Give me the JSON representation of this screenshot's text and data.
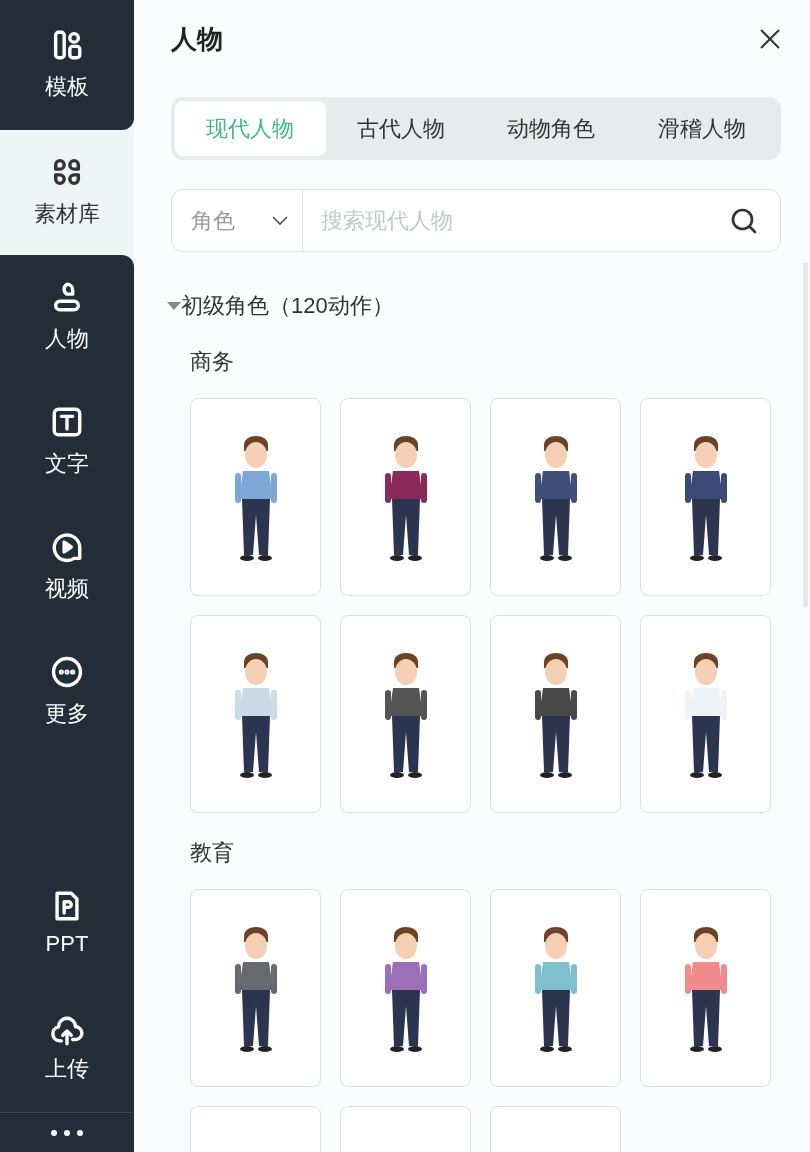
{
  "sidebar": {
    "items": [
      {
        "label": "模板",
        "kind": "template",
        "selected": false
      },
      {
        "label": "素材库",
        "kind": "library",
        "selected": true
      },
      {
        "label": "人物",
        "kind": "person",
        "selected": false
      },
      {
        "label": "文字",
        "kind": "text",
        "selected": false
      },
      {
        "label": "视频",
        "kind": "video",
        "selected": false
      },
      {
        "label": "更多",
        "kind": "more",
        "selected": false
      }
    ],
    "bottom_items": [
      {
        "label": "PPT",
        "kind": "ppt"
      },
      {
        "label": "上传",
        "kind": "upload"
      }
    ]
  },
  "panel": {
    "title": "人物",
    "tabs": [
      {
        "label": "现代人物",
        "selected": true
      },
      {
        "label": "古代人物",
        "selected": false
      },
      {
        "label": "动物角色",
        "selected": false
      },
      {
        "label": "滑稽人物",
        "selected": false
      }
    ],
    "search": {
      "filter": "角色",
      "placeholder": "搜索现代人物"
    },
    "section": {
      "title": "初级角色（120动作）",
      "expanded": true,
      "groups": [
        {
          "title": "商务",
          "cards": [
            {
              "color": "#7fa7d6"
            },
            {
              "color": "#8a2a5c"
            },
            {
              "color": "#3f4f7a"
            },
            {
              "color": "#3b4a78"
            },
            {
              "color": "#c9dbe6"
            },
            {
              "color": "#555555"
            },
            {
              "color": "#4a4a4a"
            },
            {
              "color": "#eef3f8"
            }
          ]
        },
        {
          "title": "教育",
          "cards": [
            {
              "color": "#666a70"
            },
            {
              "color": "#9c6fb8"
            },
            {
              "color": "#7fbfcf"
            },
            {
              "color": "#f08c8c"
            },
            {
              "kind": "cut_off"
            },
            {
              "kind": "cut_off"
            },
            {
              "kind": "cut_off"
            }
          ]
        }
      ]
    }
  }
}
